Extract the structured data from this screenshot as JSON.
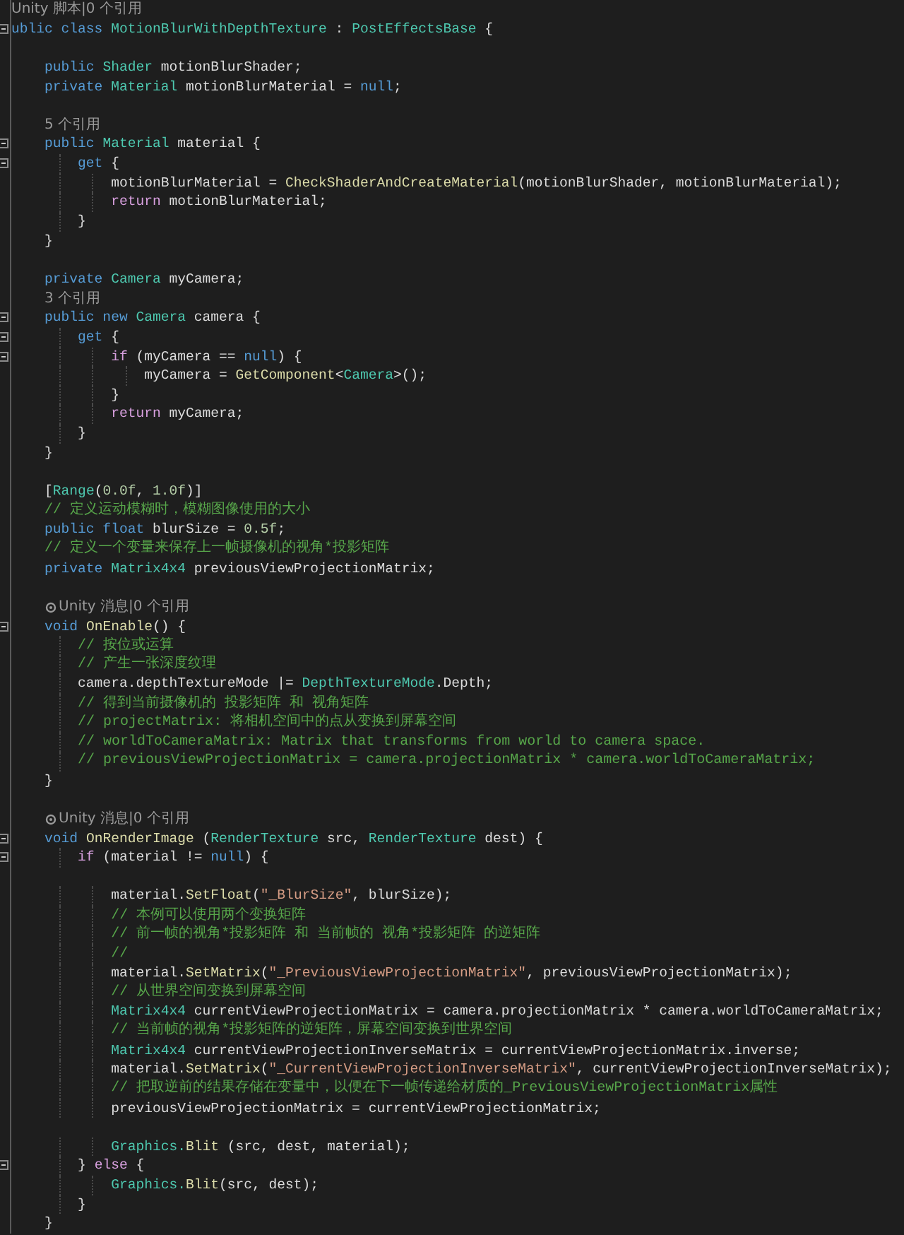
{
  "lines": [
    {
      "kind": "lens",
      "text": "Unity 脚本|0 个引用",
      "icon": false
    },
    {
      "kind": "code",
      "fold": true,
      "tokens": [
        {
          "kind": "kw",
          "text": "ublic class "
        },
        {
          "kind": "type",
          "text": "MotionBlurWithDepthTexture"
        },
        {
          "kind": "tx",
          "text": " : "
        },
        {
          "kind": "type",
          "text": "PostEffectsBase"
        },
        {
          "kind": "tx",
          "text": " {"
        }
      ]
    },
    {
      "kind": "blank"
    },
    {
      "kind": "code",
      "fold": false,
      "tokens": [
        {
          "kind": "kw",
          "text": "    public "
        },
        {
          "kind": "type",
          "text": "Shader"
        },
        {
          "kind": "tx",
          "text": " motionBlurShader;"
        }
      ]
    },
    {
      "kind": "code",
      "fold": false,
      "tokens": [
        {
          "kind": "kw",
          "text": "    private "
        },
        {
          "kind": "type",
          "text": "Material"
        },
        {
          "kind": "tx",
          "text": " motionBlurMaterial = "
        },
        {
          "kind": "kw",
          "text": "null"
        },
        {
          "kind": "tx",
          "text": ";"
        }
      ]
    },
    {
      "kind": "blank"
    },
    {
      "kind": "lens",
      "text": "    5 个引用",
      "icon": false
    },
    {
      "kind": "code",
      "fold": true,
      "tokens": [
        {
          "kind": "kw",
          "text": "    public "
        },
        {
          "kind": "type",
          "text": "Material"
        },
        {
          "kind": "tx",
          "text": " material {"
        }
      ]
    },
    {
      "kind": "code",
      "fold": true,
      "tokens": [
        {
          "kind": "kw",
          "text": "        get"
        },
        {
          "kind": "tx",
          "text": " {"
        }
      ]
    },
    {
      "kind": "code",
      "fold": false,
      "tokens": [
        {
          "kind": "tx",
          "text": "            motionBlurMaterial = "
        },
        {
          "kind": "fn",
          "text": "CheckShaderAndCreateMaterial"
        },
        {
          "kind": "tx",
          "text": "(motionBlurShader, motionBlurMaterial);"
        }
      ]
    },
    {
      "kind": "code",
      "fold": false,
      "tokens": [
        {
          "kind": "ctrl",
          "text": "            return"
        },
        {
          "kind": "tx",
          "text": " motionBlurMaterial;"
        }
      ]
    },
    {
      "kind": "code",
      "fold": false,
      "tokens": [
        {
          "kind": "tx",
          "text": "        }"
        }
      ]
    },
    {
      "kind": "code",
      "fold": false,
      "tokens": [
        {
          "kind": "tx",
          "text": "    }"
        }
      ]
    },
    {
      "kind": "blank"
    },
    {
      "kind": "code",
      "fold": false,
      "tokens": [
        {
          "kind": "kw",
          "text": "    private "
        },
        {
          "kind": "type",
          "text": "Camera"
        },
        {
          "kind": "tx",
          "text": " myCamera;"
        }
      ]
    },
    {
      "kind": "lens",
      "text": "    3 个引用",
      "icon": false
    },
    {
      "kind": "code",
      "fold": true,
      "tokens": [
        {
          "kind": "kw",
          "text": "    public new "
        },
        {
          "kind": "type",
          "text": "Camera"
        },
        {
          "kind": "tx",
          "text": " camera {"
        }
      ]
    },
    {
      "kind": "code",
      "fold": true,
      "tokens": [
        {
          "kind": "kw",
          "text": "        get"
        },
        {
          "kind": "tx",
          "text": " {"
        }
      ]
    },
    {
      "kind": "code",
      "fold": true,
      "tokens": [
        {
          "kind": "ctrl",
          "text": "            if"
        },
        {
          "kind": "tx",
          "text": " (myCamera == "
        },
        {
          "kind": "kw",
          "text": "null"
        },
        {
          "kind": "tx",
          "text": ") {"
        }
      ]
    },
    {
      "kind": "code",
      "fold": false,
      "tokens": [
        {
          "kind": "tx",
          "text": "                myCamera = "
        },
        {
          "kind": "fn",
          "text": "GetComponent"
        },
        {
          "kind": "tx",
          "text": "<"
        },
        {
          "kind": "type",
          "text": "Camera"
        },
        {
          "kind": "tx",
          "text": ">();"
        }
      ]
    },
    {
      "kind": "code",
      "fold": false,
      "tokens": [
        {
          "kind": "tx",
          "text": "            }"
        }
      ]
    },
    {
      "kind": "code",
      "fold": false,
      "tokens": [
        {
          "kind": "ctrl",
          "text": "            return"
        },
        {
          "kind": "tx",
          "text": " myCamera;"
        }
      ]
    },
    {
      "kind": "code",
      "fold": false,
      "tokens": [
        {
          "kind": "tx",
          "text": "        }"
        }
      ]
    },
    {
      "kind": "code",
      "fold": false,
      "tokens": [
        {
          "kind": "tx",
          "text": "    }"
        }
      ]
    },
    {
      "kind": "blank"
    },
    {
      "kind": "code",
      "fold": false,
      "tokens": [
        {
          "kind": "tx",
          "text": "    ["
        },
        {
          "kind": "type",
          "text": "Range"
        },
        {
          "kind": "tx",
          "text": "("
        },
        {
          "kind": "num",
          "text": "0.0f"
        },
        {
          "kind": "tx",
          "text": ", "
        },
        {
          "kind": "num",
          "text": "1.0f"
        },
        {
          "kind": "tx",
          "text": ")]"
        }
      ]
    },
    {
      "kind": "code",
      "fold": false,
      "tokens": [
        {
          "kind": "cm",
          "text": "    // 定义运动模糊时，模糊图像使用的大小"
        }
      ]
    },
    {
      "kind": "code",
      "fold": false,
      "tokens": [
        {
          "kind": "kw",
          "text": "    public float"
        },
        {
          "kind": "tx",
          "text": " blurSize = "
        },
        {
          "kind": "num",
          "text": "0.5f"
        },
        {
          "kind": "tx",
          "text": ";"
        }
      ]
    },
    {
      "kind": "code",
      "fold": false,
      "tokens": [
        {
          "kind": "cm",
          "text": "    // 定义一个变量来保存上一帧摄像机的视角*投影矩阵"
        }
      ]
    },
    {
      "kind": "code",
      "fold": false,
      "tokens": [
        {
          "kind": "kw",
          "text": "    private "
        },
        {
          "kind": "type",
          "text": "Matrix4x4"
        },
        {
          "kind": "tx",
          "text": " previousViewProjectionMatrix;"
        }
      ]
    },
    {
      "kind": "blank"
    },
    {
      "kind": "lens",
      "text": "    Unity 消息|0 个引用",
      "icon": true
    },
    {
      "kind": "code",
      "fold": true,
      "tokens": [
        {
          "kind": "kw",
          "text": "    void "
        },
        {
          "kind": "fn",
          "text": "OnEnable"
        },
        {
          "kind": "tx",
          "text": "() {"
        }
      ]
    },
    {
      "kind": "code",
      "fold": false,
      "tokens": [
        {
          "kind": "cm",
          "text": "        // 按位或运算"
        }
      ]
    },
    {
      "kind": "code",
      "fold": false,
      "tokens": [
        {
          "kind": "cm",
          "text": "        // 产生一张深度纹理"
        }
      ]
    },
    {
      "kind": "code",
      "fold": false,
      "tokens": [
        {
          "kind": "tx",
          "text": "        camera.depthTextureMode |= "
        },
        {
          "kind": "type",
          "text": "DepthTextureMode"
        },
        {
          "kind": "tx",
          "text": ".Depth;"
        }
      ]
    },
    {
      "kind": "code",
      "fold": false,
      "tokens": [
        {
          "kind": "cm",
          "text": "        // 得到当前摄像机的 投影矩阵 和 视角矩阵"
        }
      ]
    },
    {
      "kind": "code",
      "fold": false,
      "tokens": [
        {
          "kind": "cm",
          "text": "        // projectMatrix: 将相机空间中的点从变换到屏幕空间"
        }
      ]
    },
    {
      "kind": "code",
      "fold": false,
      "tokens": [
        {
          "kind": "cm",
          "text": "        // worldToCameraMatrix: Matrix that transforms from world to camera space."
        }
      ]
    },
    {
      "kind": "code",
      "fold": false,
      "tokens": [
        {
          "kind": "cm",
          "text": "        // previousViewProjectionMatrix = camera.projectionMatrix * camera.worldToCameraMatrix;"
        }
      ]
    },
    {
      "kind": "code",
      "fold": false,
      "tokens": [
        {
          "kind": "tx",
          "text": "    }"
        }
      ]
    },
    {
      "kind": "blank"
    },
    {
      "kind": "lens",
      "text": "    Unity 消息|0 个引用",
      "icon": true
    },
    {
      "kind": "code",
      "fold": true,
      "tokens": [
        {
          "kind": "kw",
          "text": "    void "
        },
        {
          "kind": "fn",
          "text": "OnRenderImage"
        },
        {
          "kind": "tx",
          "text": " ("
        },
        {
          "kind": "type",
          "text": "RenderTexture"
        },
        {
          "kind": "tx",
          "text": " src, "
        },
        {
          "kind": "type",
          "text": "RenderTexture"
        },
        {
          "kind": "tx",
          "text": " dest) {"
        }
      ]
    },
    {
      "kind": "code",
      "fold": true,
      "tokens": [
        {
          "kind": "ctrl",
          "text": "        if"
        },
        {
          "kind": "tx",
          "text": " (material != "
        },
        {
          "kind": "kw",
          "text": "null"
        },
        {
          "kind": "tx",
          "text": ") {"
        }
      ]
    },
    {
      "kind": "blank"
    },
    {
      "kind": "code",
      "fold": false,
      "tokens": [
        {
          "kind": "tx",
          "text": "            material."
        },
        {
          "kind": "fn",
          "text": "SetFloat"
        },
        {
          "kind": "tx",
          "text": "("
        },
        {
          "kind": "str",
          "text": "\"_BlurSize\""
        },
        {
          "kind": "tx",
          "text": ", blurSize);"
        }
      ]
    },
    {
      "kind": "code",
      "fold": false,
      "tokens": [
        {
          "kind": "cm",
          "text": "            // 本例可以使用两个变换矩阵"
        }
      ]
    },
    {
      "kind": "code",
      "fold": false,
      "tokens": [
        {
          "kind": "cm",
          "text": "            // 前一帧的视角*投影矩阵 和 当前帧的 视角*投影矩阵 的逆矩阵"
        }
      ]
    },
    {
      "kind": "code",
      "fold": false,
      "tokens": [
        {
          "kind": "cm",
          "text": "            //"
        }
      ]
    },
    {
      "kind": "code",
      "fold": false,
      "tokens": [
        {
          "kind": "tx",
          "text": "            material."
        },
        {
          "kind": "fn",
          "text": "SetMatrix"
        },
        {
          "kind": "tx",
          "text": "("
        },
        {
          "kind": "str",
          "text": "\"_PreviousViewProjectionMatrix\""
        },
        {
          "kind": "tx",
          "text": ", previousViewProjectionMatrix);"
        }
      ]
    },
    {
      "kind": "code",
      "fold": false,
      "tokens": [
        {
          "kind": "cm",
          "text": "            // 从世界空间变换到屏幕空间"
        }
      ]
    },
    {
      "kind": "code",
      "fold": false,
      "tokens": [
        {
          "kind": "type",
          "text": "            Matrix4x4"
        },
        {
          "kind": "tx",
          "text": " currentViewProjectionMatrix = camera.projectionMatrix * camera.worldToCameraMatrix;"
        }
      ]
    },
    {
      "kind": "code",
      "fold": false,
      "tokens": [
        {
          "kind": "cm",
          "text": "            // 当前帧的视角*投影矩阵的逆矩阵，屏幕空间变换到世界空间"
        }
      ]
    },
    {
      "kind": "code",
      "fold": false,
      "tokens": [
        {
          "kind": "type",
          "text": "            Matrix4x4"
        },
        {
          "kind": "tx",
          "text": " currentViewProjectionInverseMatrix = currentViewProjectionMatrix.inverse;"
        }
      ]
    },
    {
      "kind": "code",
      "fold": false,
      "tokens": [
        {
          "kind": "tx",
          "text": "            material."
        },
        {
          "kind": "fn",
          "text": "SetMatrix"
        },
        {
          "kind": "tx",
          "text": "("
        },
        {
          "kind": "str",
          "text": "\"_CurrentViewProjectionInverseMatrix\""
        },
        {
          "kind": "tx",
          "text": ", currentViewProjectionInverseMatrix);"
        }
      ]
    },
    {
      "kind": "code",
      "fold": false,
      "tokens": [
        {
          "kind": "cm",
          "text": "            // 把取逆前的结果存储在变量中，以便在下一帧传递给材质的_PreviousViewProjectionMatrix属性"
        }
      ]
    },
    {
      "kind": "code",
      "fold": false,
      "tokens": [
        {
          "kind": "tx",
          "text": "            previousViewProjectionMatrix = currentViewProjectionMatrix;"
        }
      ]
    },
    {
      "kind": "blank"
    },
    {
      "kind": "code",
      "fold": false,
      "tokens": [
        {
          "kind": "type",
          "text": "            Graphics."
        },
        {
          "kind": "fn",
          "text": "Blit"
        },
        {
          "kind": "tx",
          "text": " (src, dest, material);"
        }
      ]
    },
    {
      "kind": "code",
      "fold": true,
      "tokens": [
        {
          "kind": "tx",
          "text": "        } "
        },
        {
          "kind": "ctrl",
          "text": "else"
        },
        {
          "kind": "tx",
          "text": " {"
        }
      ]
    },
    {
      "kind": "code",
      "fold": false,
      "tokens": [
        {
          "kind": "type",
          "text": "            Graphics."
        },
        {
          "kind": "fn",
          "text": "Blit"
        },
        {
          "kind": "tx",
          "text": "(src, dest);"
        }
      ]
    },
    {
      "kind": "code",
      "fold": false,
      "tokens": [
        {
          "kind": "tx",
          "text": "        }"
        }
      ]
    },
    {
      "kind": "code",
      "fold": false,
      "tokens": [
        {
          "kind": "tx",
          "text": "    }"
        }
      ]
    }
  ]
}
